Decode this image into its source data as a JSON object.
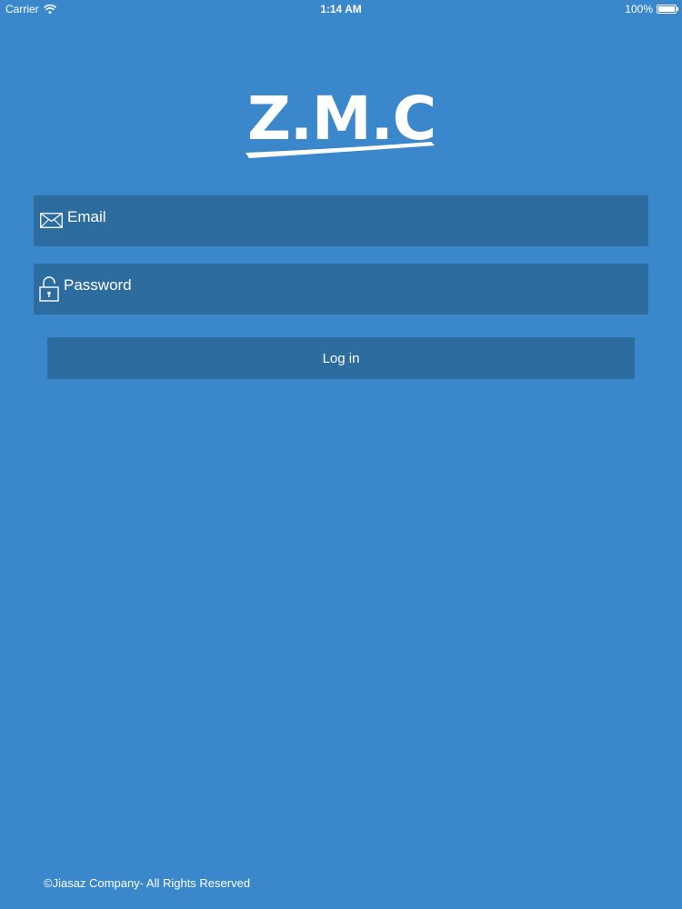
{
  "status_bar": {
    "carrier": "Carrier",
    "time": "1:14 AM",
    "battery_percent": "100%",
    "battery_level": 1.0
  },
  "logo": {
    "text": "Z.M.C"
  },
  "form": {
    "email": {
      "placeholder": "Email",
      "value": "",
      "icon": "envelope-icon"
    },
    "password": {
      "placeholder": "Password",
      "value": "",
      "icon": "unlock-icon"
    },
    "login_button": {
      "label": "Log in"
    }
  },
  "footer": {
    "copyright": "©Jiasaz Company- All Rights Reserved"
  },
  "colors": {
    "background": "#3a88cb",
    "field_background": "#2d6c9e",
    "text": "#ffffff"
  }
}
